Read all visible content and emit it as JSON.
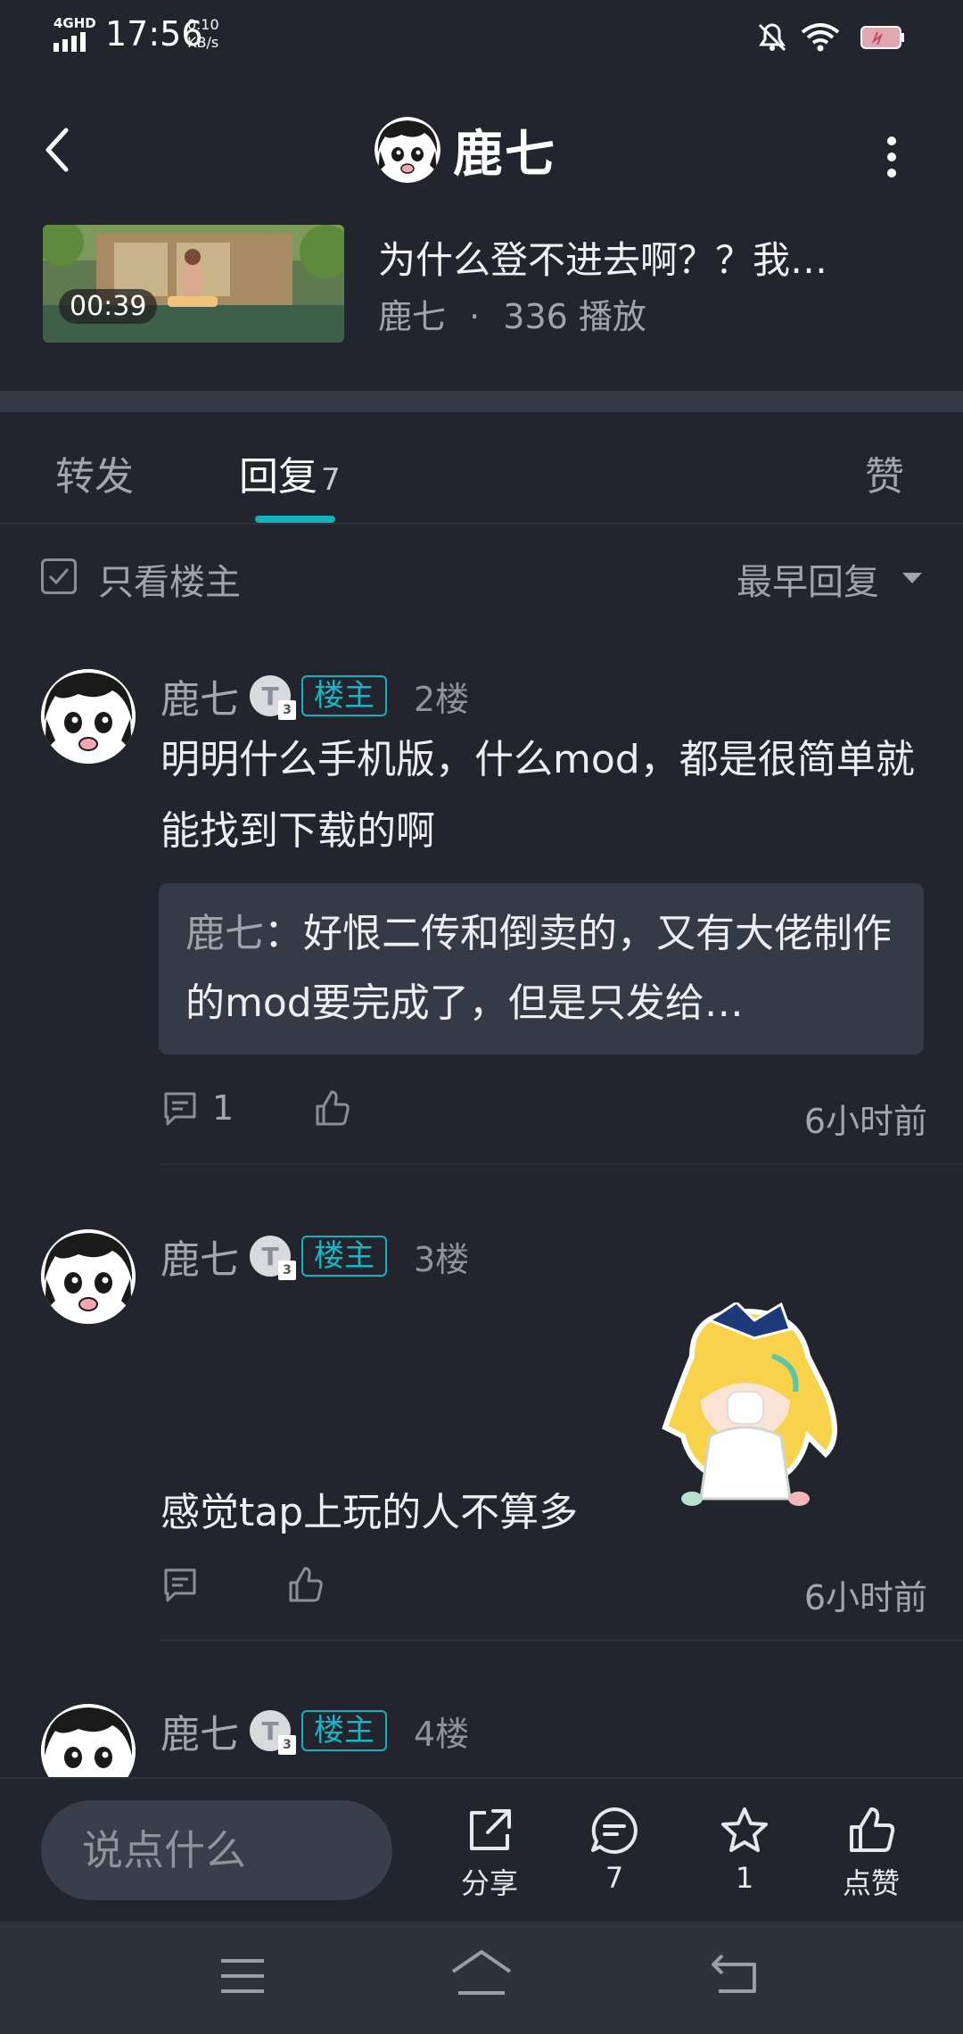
{
  "status_bar": {
    "network": "4GHD",
    "time": "17:56",
    "speed_value": "0.10",
    "speed_unit": "KB/s"
  },
  "header": {
    "title": "鹿七",
    "back_icon": "chevron-left-icon",
    "more_icon": "more-vertical-icon"
  },
  "video": {
    "duration": "00:39",
    "title": "为什么登不进去啊？？我…",
    "author": "鹿七",
    "dot": "·",
    "plays": "336 播放"
  },
  "tabs": {
    "forward": "转发",
    "reply": "回复",
    "reply_count": "7",
    "like": "赞"
  },
  "filter": {
    "only_op": "只看楼主",
    "sort": "最早回复"
  },
  "comments": [
    {
      "name": "鹿七",
      "badge_letter": "T",
      "level": "3",
      "op_badge": "楼主",
      "floor": "2楼",
      "text": "明明什么手机版，什么mod，都是很简单就能找到下载的啊",
      "quote_name": "鹿七",
      "quote_text": "：好恨二传和倒卖的，又有大佬制作的mod要完成了，但是只发给…",
      "reply_count": "1",
      "time": "6小时前"
    },
    {
      "name": "鹿七",
      "badge_letter": "T",
      "level": "3",
      "op_badge": "楼主",
      "floor": "3楼",
      "text": "感觉tap上玩的人不算多",
      "time": "6小时前"
    },
    {
      "name": "鹿七",
      "badge_letter": "T",
      "level": "3",
      "op_badge": "楼主",
      "floor": "4楼"
    }
  ],
  "bottom_bar": {
    "input_placeholder": "说点什么",
    "share": "分享",
    "comments": "7",
    "favorites": "1",
    "like": "点赞"
  },
  "colors": {
    "background": "#22252e",
    "accent": "#15b1c0",
    "quote_bg": "#363a47"
  }
}
